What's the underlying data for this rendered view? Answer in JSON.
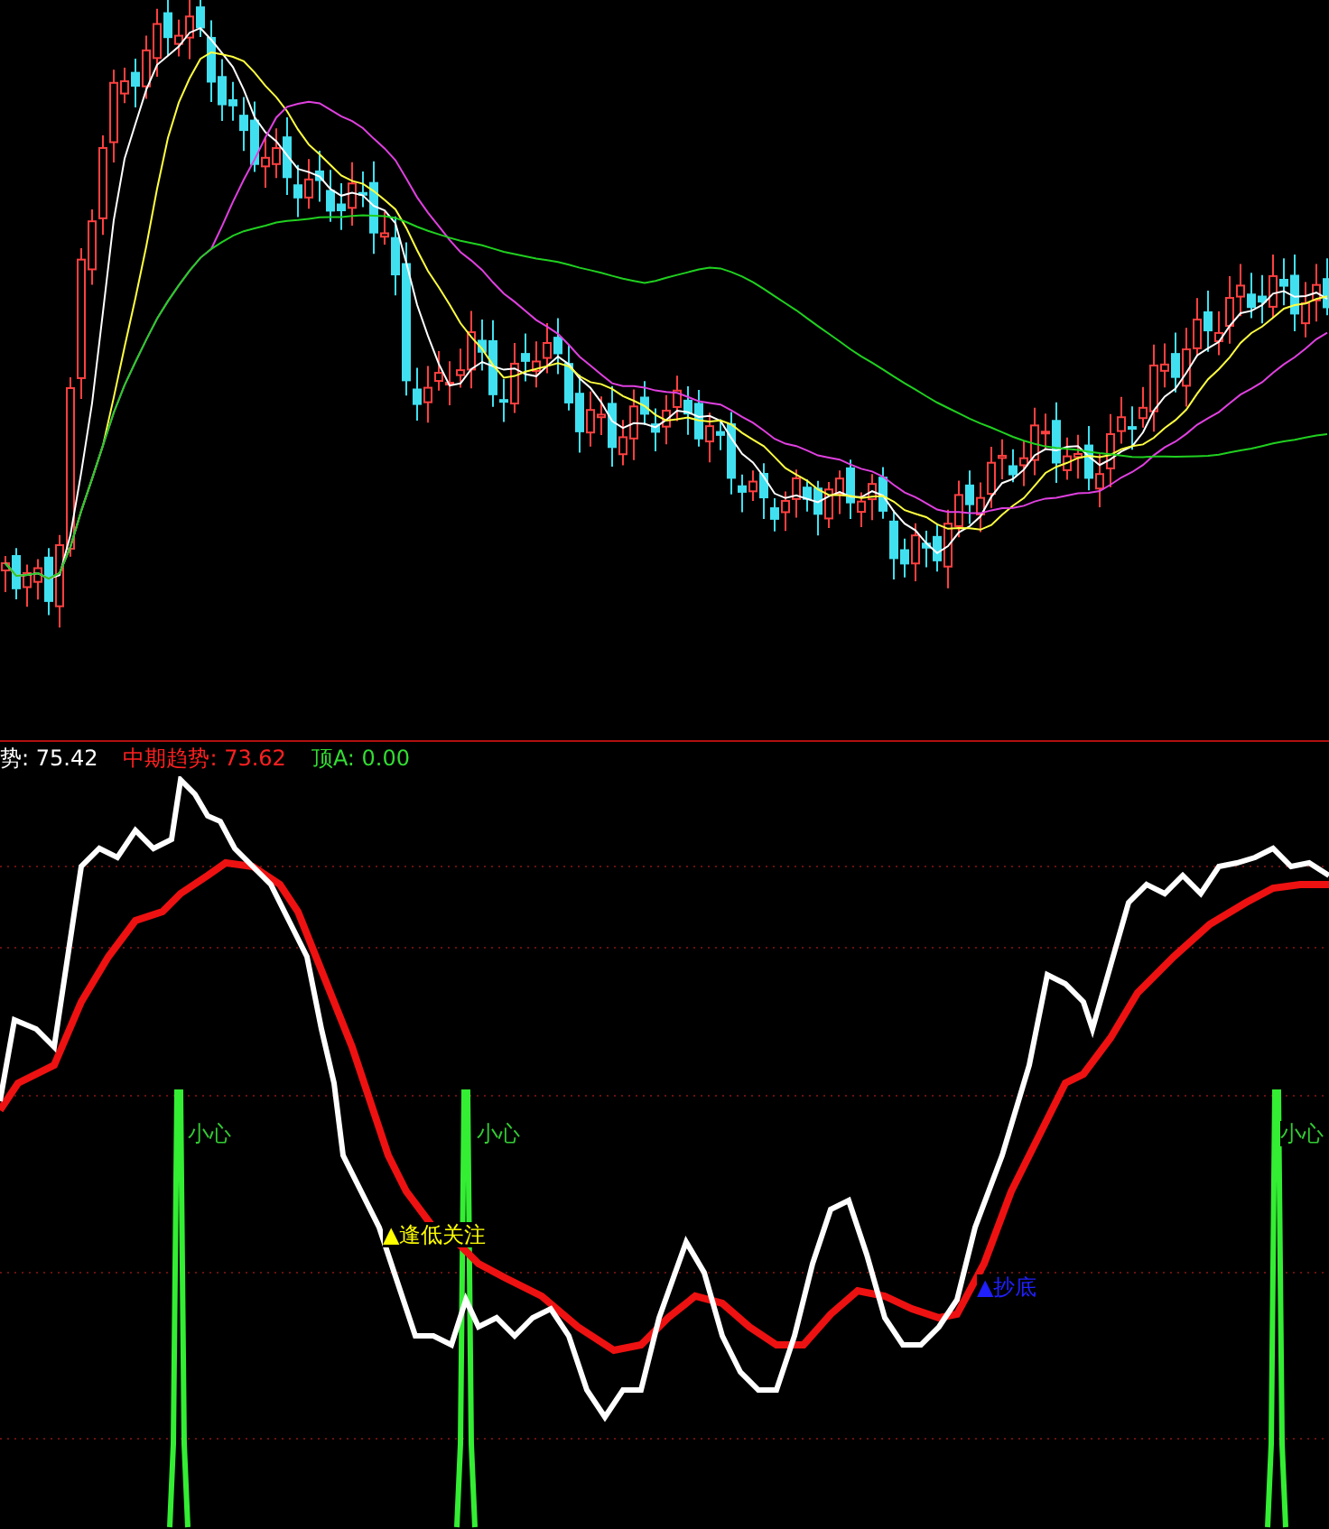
{
  "legend": [
    {
      "text": "势: 75.42",
      "color": "#ffffff"
    },
    {
      "text": "中期趋势: 73.62",
      "color": "#ff2020"
    },
    {
      "text": "顶A: 0.00",
      "color": "#33dd33"
    }
  ],
  "signals": [
    {
      "kind": "caution",
      "text": "小心"
    },
    {
      "kind": "caution",
      "text": "小心"
    },
    {
      "kind": "caution",
      "text": "小心"
    },
    {
      "kind": "watch",
      "text": "▲逢低关注"
    },
    {
      "kind": "bottom",
      "text": "▲抄底"
    }
  ]
}
